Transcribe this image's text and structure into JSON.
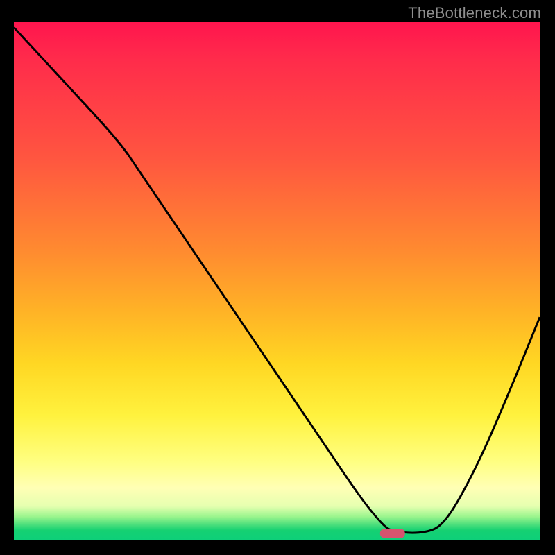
{
  "watermark": "TheBottleneck.com",
  "colors": {
    "bg_black": "#000000",
    "watermark_gray": "#8e8e8e",
    "grad_top": "#ff154e",
    "grad_bottom": "#0ecf79",
    "curve": "#000000",
    "marker": "#d6546f"
  },
  "chart_data": {
    "type": "line",
    "title": "",
    "xlabel": "",
    "ylabel": "",
    "xlim": [
      0,
      100
    ],
    "ylim": [
      0,
      100
    ],
    "grid": false,
    "legend": false,
    "x": [
      0,
      10,
      20,
      24,
      30,
      40,
      50,
      60,
      66,
      70,
      72,
      78,
      82,
      88,
      94,
      100
    ],
    "values": [
      99,
      88,
      77,
      71,
      62,
      47,
      32,
      17,
      8,
      3,
      1.5,
      1.2,
      3,
      14,
      28,
      43
    ],
    "marker": {
      "x": 72,
      "y": 1.2
    },
    "notes": "x is a normalized horizontal position (0–100, left→right). y is a normalized value (0–100) where 0 is the green baseline at the bottom and 100 is the top of the gradient. No axis ticks, labels, or legend are rendered in the source image; the curve descends from upper-left, bottoms out near x≈72 where a small rounded red marker sits on the green, then rises toward the right edge."
  }
}
